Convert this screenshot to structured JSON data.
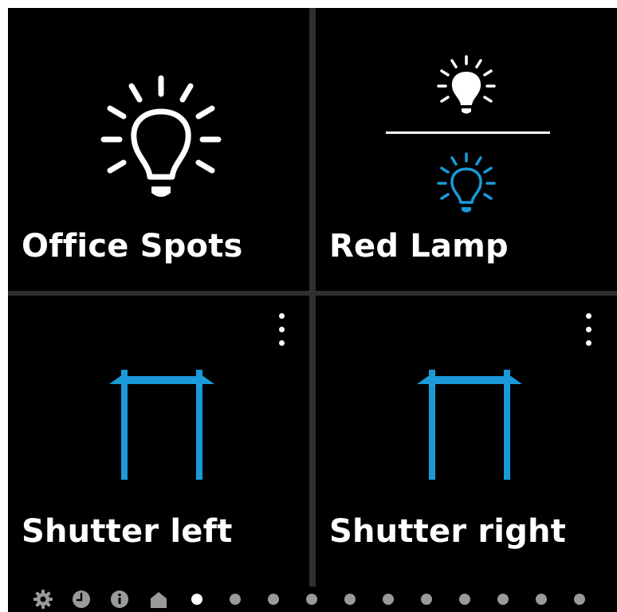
{
  "tiles": [
    {
      "id": "office-spots",
      "label": "Office Spots",
      "icon": "lightbulb-icon"
    },
    {
      "id": "red-lamp",
      "label": "Red Lamp",
      "icon": "dual-lightbulb-icon"
    },
    {
      "id": "shutter-left",
      "label": "Shutter left",
      "icon": "shutter-icon",
      "has_menu": true
    },
    {
      "id": "shutter-right",
      "label": "Shutter right",
      "icon": "shutter-icon",
      "has_menu": true
    }
  ],
  "pager": {
    "icons": [
      "gear-icon",
      "clock-icon",
      "info-icon",
      "home-icon"
    ],
    "dot_count": 11,
    "active_dot": 0
  },
  "colors": {
    "background": "#000000",
    "text": "#ffffff",
    "accent": "#1a9ad9",
    "divider": "#2f2f2f",
    "inactive_pager": "#9a9a9a"
  }
}
